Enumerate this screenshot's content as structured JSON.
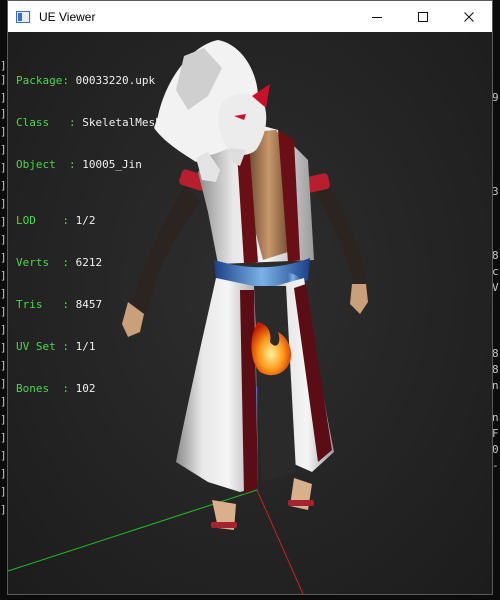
{
  "window": {
    "title": "UE Viewer",
    "controls": {
      "minimize": "minimize-icon",
      "maximize": "maximize-icon",
      "close": "close-icon"
    }
  },
  "info": {
    "package_label": "Package",
    "package_value": "00033220.upk",
    "class_label": "Class",
    "class_value": "SkeletalMesh",
    "object_label": "Object",
    "object_value": "10005_Jin",
    "lod_label": "LOD",
    "lod_value": "1/2",
    "verts_label": "Verts",
    "verts_value": "6212",
    "tris_label": "Tris",
    "tris_value": "8457",
    "uvset_label": "UV Set",
    "uvset_value": "1/1",
    "bones_label": "Bones",
    "bones_value": "102"
  },
  "background_console": {
    "left_glyphs": [
      "]",
      "]",
      "]",
      "]",
      "]",
      "]",
      "]",
      "]",
      "]",
      "]",
      "]",
      "]",
      "]",
      "]",
      "]",
      "]",
      "]",
      "]",
      "]",
      "]",
      "]",
      "]",
      "]",
      "]",
      "]",
      "]",
      "]",
      "]",
      "]",
      "]",
      "]",
      "]",
      "]",
      "]",
      "]",
      "]",
      "]",
      "]",
      "]",
      "]",
      "]",
      "]"
    ],
    "right_glyphs": [
      "9",
      "3",
      "8",
      "c",
      "V",
      "8",
      "8",
      "n",
      "n",
      "F",
      "0",
      "-"
    ]
  },
  "colors": {
    "info_label": "#4cd64c",
    "axis_x": "#cc2020",
    "axis_y": "#20c020",
    "axis_z": "#2040ff"
  }
}
